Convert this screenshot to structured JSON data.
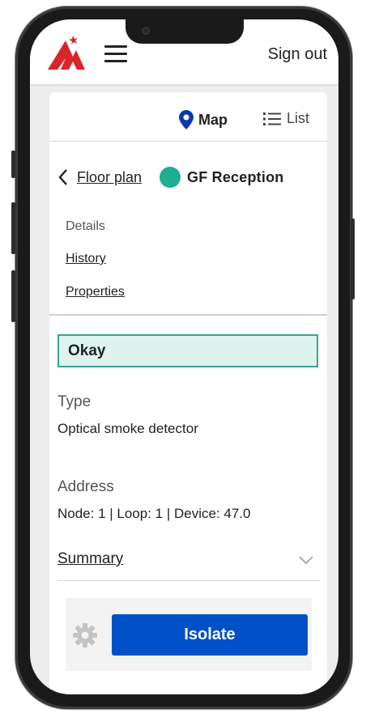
{
  "header": {
    "logo_icon": "red-flame-logo-icon",
    "menu_icon": "hamburger-menu-icon",
    "signout_label": "Sign out"
  },
  "view_toggle": {
    "map_label": "Map",
    "map_icon": "map-pin-icon",
    "list_label": "List",
    "list_icon": "list-icon"
  },
  "breadcrumb": {
    "back_icon": "chevron-left-icon",
    "parent_label": "Floor plan",
    "device_name": "GF Reception",
    "status_color": "#1fae94"
  },
  "tabs": [
    {
      "label": "Details",
      "active": true
    },
    {
      "label": "History",
      "active": false
    },
    {
      "label": "Properties",
      "active": false
    }
  ],
  "status": {
    "label": "Okay",
    "fill": "#dff3ee",
    "border": "#33a690"
  },
  "details": {
    "type_label": "Type",
    "type_value": "Optical smoke detector",
    "address_label": "Address",
    "address_value": "Node: 1 | Loop: 1 | Device: 47.0"
  },
  "summary": {
    "label": "Summary",
    "icon": "chevron-down-icon"
  },
  "actions": {
    "settings_icon": "gear-icon",
    "isolate_label": "Isolate",
    "isolate_color": "#0051c7"
  }
}
